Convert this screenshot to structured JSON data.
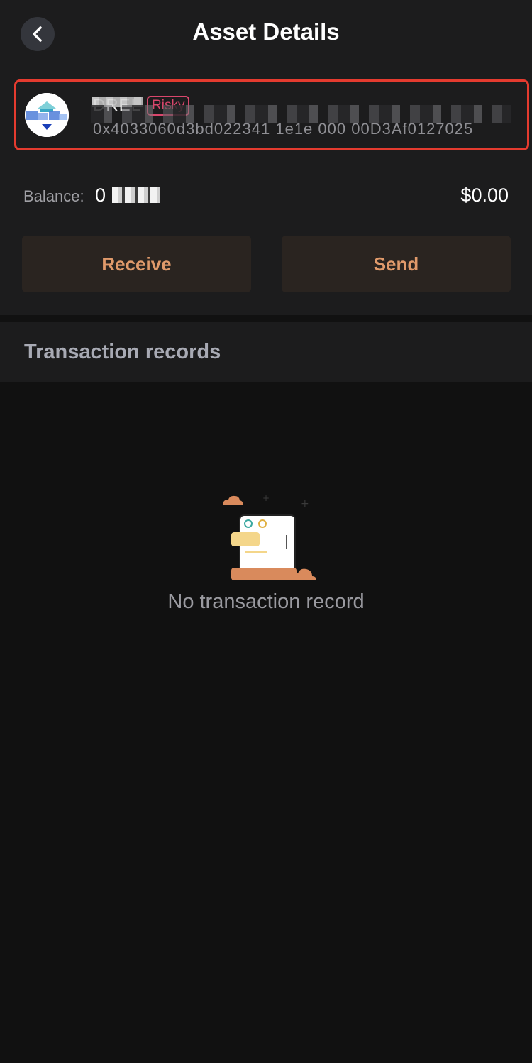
{
  "header": {
    "title": "Asset Details",
    "back_icon": "chevron-left-icon"
  },
  "token": {
    "symbol": "DREL",
    "risk_label": "Risky",
    "address": "0x4033060d3bd022341 1e1e 000 00D3Af0127025"
  },
  "balance": {
    "label": "Balance:",
    "amount": "0",
    "usd_value": "$0.00"
  },
  "actions": {
    "receive_label": "Receive",
    "send_label": "Send"
  },
  "transactions": {
    "section_title": "Transaction records",
    "empty_message": "No transaction record",
    "empty_icon": "empty-document-icon"
  },
  "colors": {
    "accent": "#e09a6b",
    "risk": "#d9466c",
    "highlight_border": "#e53b2f"
  }
}
